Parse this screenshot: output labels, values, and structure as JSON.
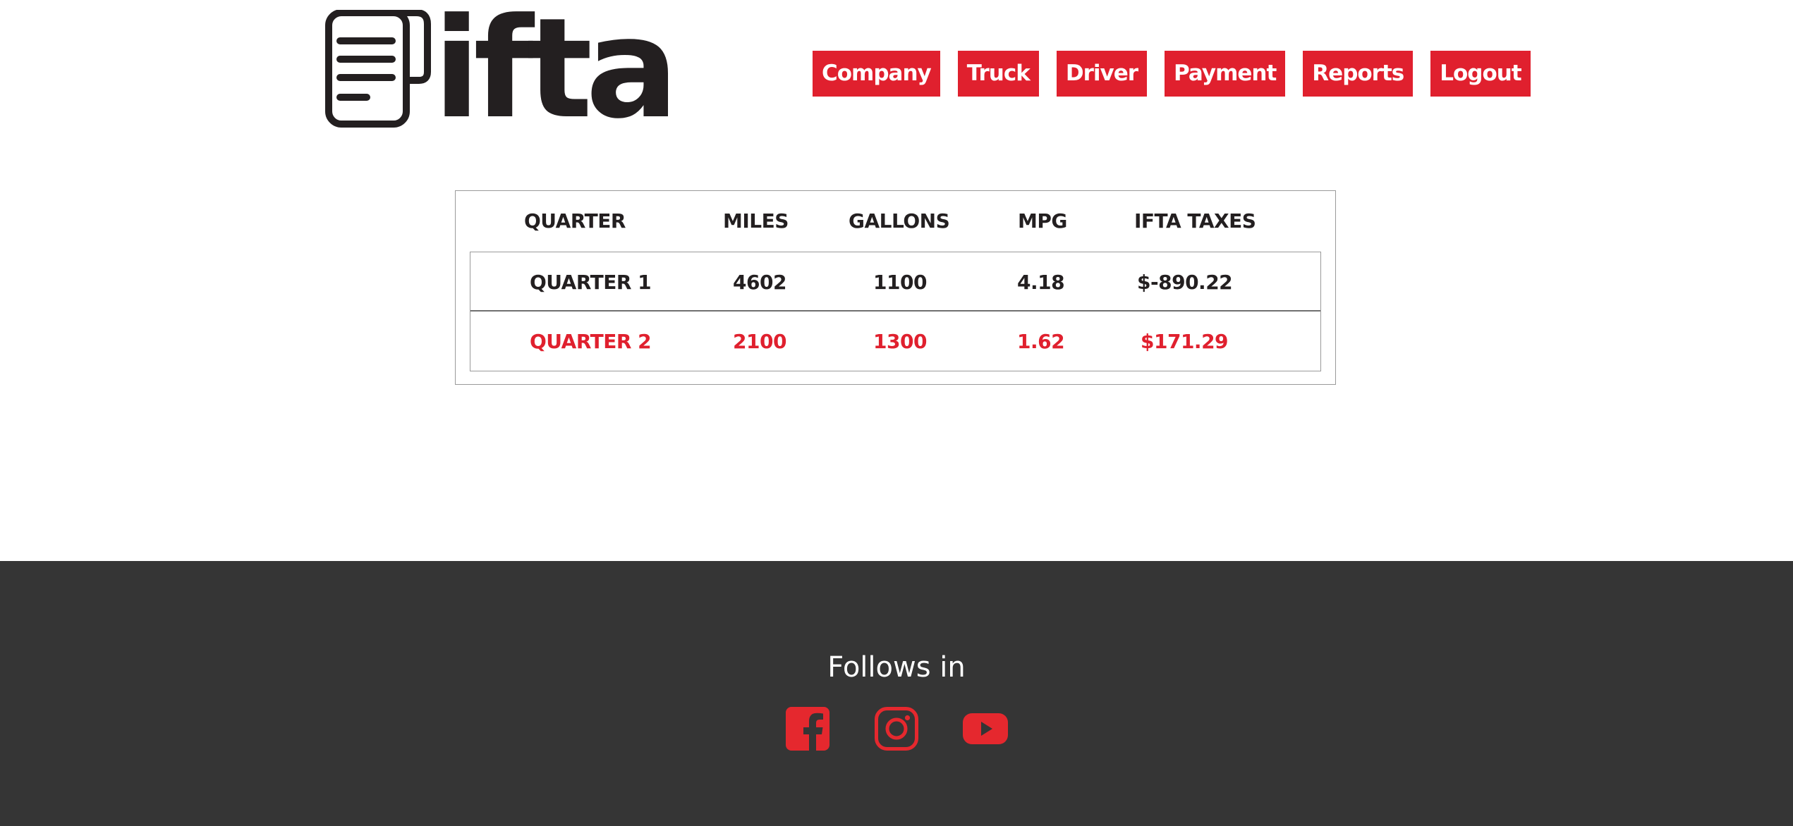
{
  "brand": {
    "logo_text": "ifta",
    "logo_icon": "document-icon",
    "dark_color": "#231f20"
  },
  "nav": {
    "items": [
      {
        "label": "Company"
      },
      {
        "label": "Truck"
      },
      {
        "label": "Driver"
      },
      {
        "label": "Payment"
      },
      {
        "label": "Reports"
      },
      {
        "label": "Logout"
      }
    ],
    "accent_color": "#e0202e"
  },
  "report": {
    "columns": [
      "QUARTER",
      "MILES",
      "GALLONS",
      "MPG",
      "IFTA TAXES"
    ],
    "rows": [
      {
        "quarter": "QUARTER 1",
        "miles": "4602",
        "gallons": "1100",
        "mpg": "4.18",
        "taxes": "$-890.22",
        "color": "#231f20"
      },
      {
        "quarter": "QUARTER 2",
        "miles": "2100",
        "gallons": "1300",
        "mpg": "1.62",
        "taxes": "$171.29",
        "color": "#e0202e"
      }
    ]
  },
  "footer": {
    "follow_text": "Follows in",
    "background": "#353535",
    "social": [
      {
        "icon": "facebook-icon"
      },
      {
        "icon": "instagram-icon"
      },
      {
        "icon": "youtube-icon"
      }
    ]
  }
}
